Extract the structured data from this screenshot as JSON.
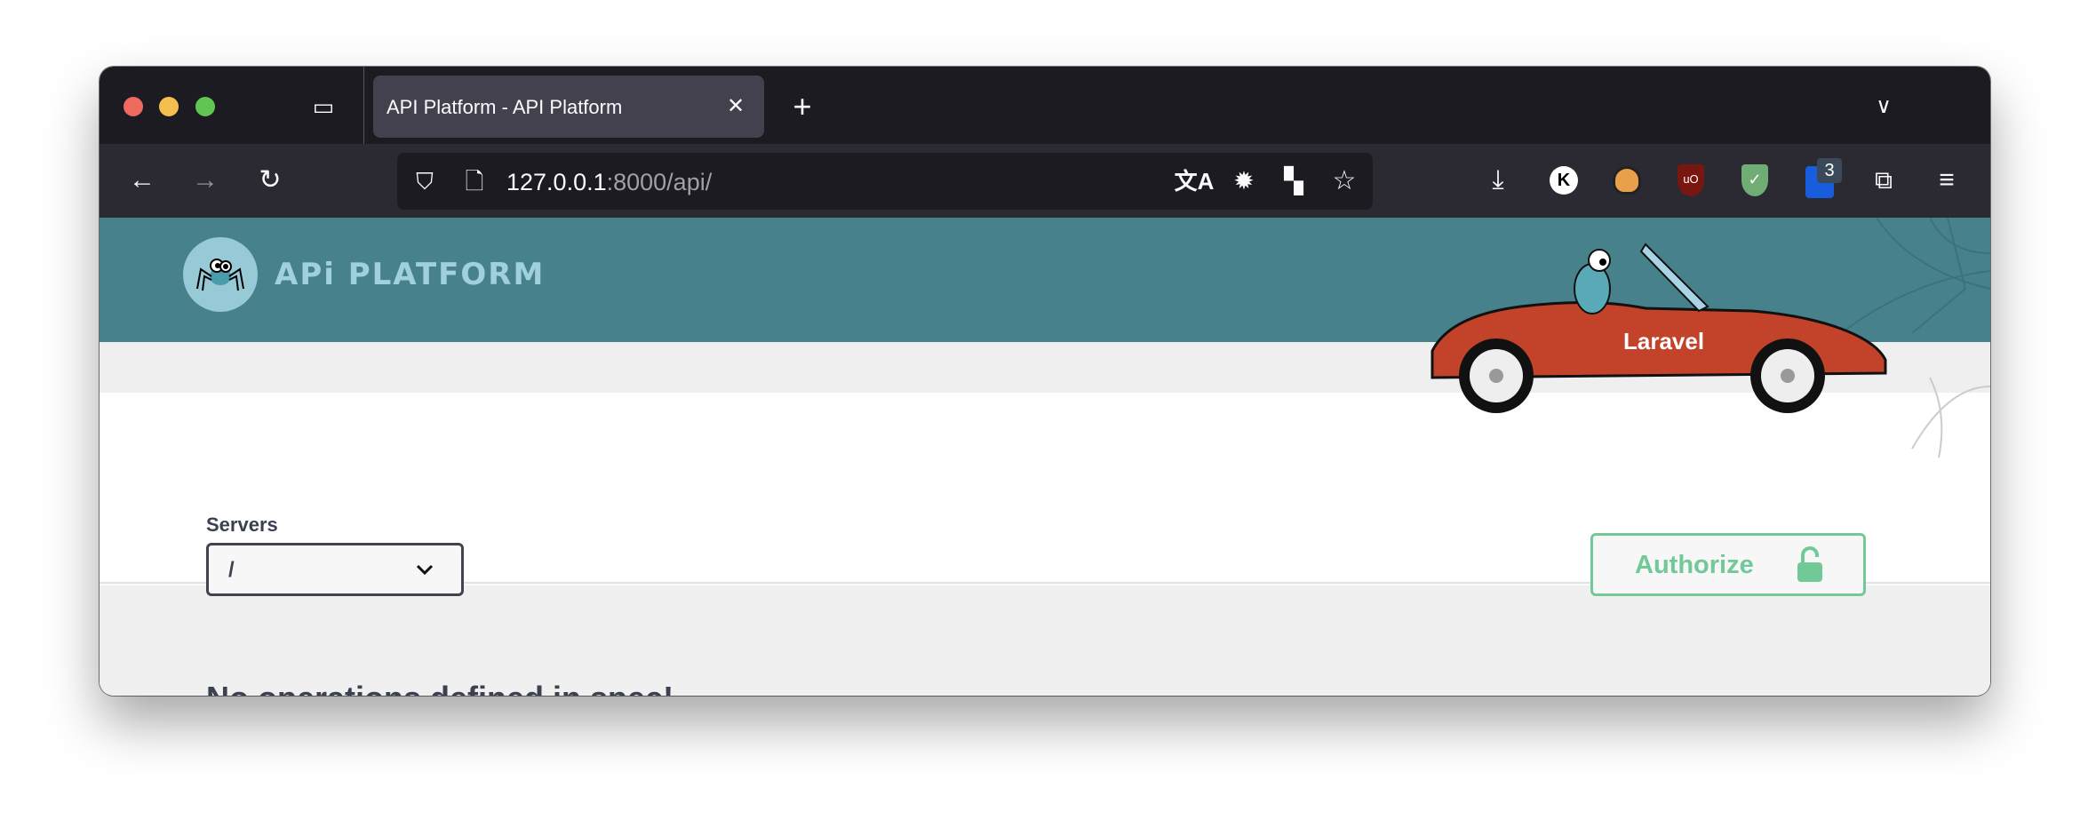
{
  "browser": {
    "tab_title": "API Platform - API Platform",
    "url_host": "127.0.0.1",
    "url_rest": ":8000/api/",
    "extension_badge": "3",
    "icons": [
      "tab-groups-icon",
      "close-icon",
      "plus-icon",
      "chevron-down-icon",
      "back-icon",
      "forward-icon",
      "reload-icon",
      "shield-icon",
      "page-icon",
      "translate-icon",
      "bug-icon",
      "qr-grid-icon",
      "star-icon",
      "download-icon",
      "k-extension-icon",
      "badger-icon",
      "ublock-icon",
      "adguard-icon",
      "bitwarden-icon",
      "extensions-icon",
      "menu-icon"
    ]
  },
  "header": {
    "logo_text": "APi PLATFORM",
    "car_text": "Laravel",
    "header_color": "#47818c"
  },
  "servers": {
    "label": "Servers",
    "selected": "/"
  },
  "authorize": {
    "label": "Authorize",
    "color": "#72c997"
  },
  "message": "No operations defined in spec!"
}
